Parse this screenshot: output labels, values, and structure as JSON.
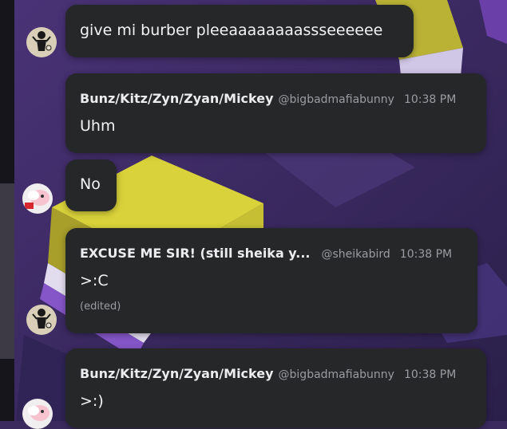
{
  "messages": [
    {
      "body": "give mi burber pleeaaaaaaaassseeeeee"
    },
    {
      "author": "Bunz/Kitz/Zyn/Zyan/Mickey",
      "handle": "@bigbadmafiabunny",
      "time": "10:38 PM",
      "body": "Uhm"
    },
    {
      "body": "No"
    },
    {
      "author": "EXCUSE ME SIR! (still sheika y...",
      "handle": "@sheikabird",
      "time": "10:38 PM",
      "body": ">:C",
      "edited": "(edited)"
    },
    {
      "author": "Bunz/Kitz/Zyn/Zyan/Mickey",
      "handle": "@bigbadmafiabunny",
      "time": "10:38 PM",
      "body": ">:)"
    }
  ],
  "avatars": [
    {
      "icon": "silhouette-avatar-icon",
      "bg": "#d9cfb8"
    },
    {
      "icon": "bird-avatar-icon",
      "bg": "#f1eef0"
    },
    {
      "icon": "silhouette-avatar-icon",
      "bg": "#d9cfb8"
    },
    {
      "icon": "bird-avatar-icon",
      "bg": "#f1eef0"
    }
  ],
  "colors": {
    "bubble": "#262729",
    "name": "#ececef",
    "meta": "#9b9ca3",
    "accent_yellow": "#d9d23a",
    "background_purple": "#3a2a5e"
  }
}
